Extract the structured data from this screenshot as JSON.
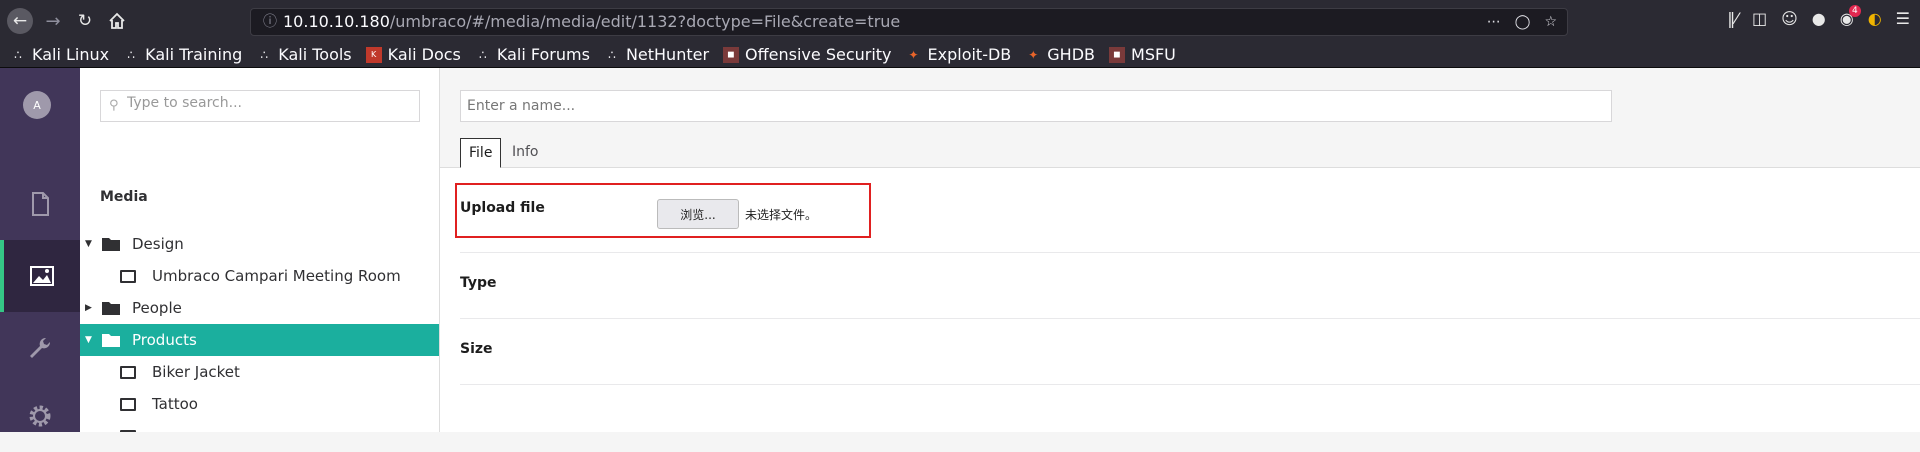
{
  "browser": {
    "url_host": "10.10.10.180",
    "url_path": "/umbraco/#/media/media/edit/1132?doctype=File&create=true",
    "notification_count": "4"
  },
  "bookmarks": [
    {
      "label": "Kali Linux",
      "icon": "kali-dragon-icon"
    },
    {
      "label": "Kali Training",
      "icon": "kali-dragon-icon"
    },
    {
      "label": "Kali Tools",
      "icon": "kali-dragon-icon"
    },
    {
      "label": "Kali Docs",
      "icon": "kali-docs-icon"
    },
    {
      "label": "Kali Forums",
      "icon": "kali-dragon-icon"
    },
    {
      "label": "NetHunter",
      "icon": "nethunter-icon"
    },
    {
      "label": "Offensive Security",
      "icon": "offsec-icon"
    },
    {
      "label": "Exploit-DB",
      "icon": "exploitdb-icon"
    },
    {
      "label": "GHDB",
      "icon": "ghdb-icon"
    },
    {
      "label": "MSFU",
      "icon": "msfu-icon"
    }
  ],
  "sidebar": {
    "avatar_initial": "A",
    "sections": [
      "content-icon",
      "media-icon",
      "settings-wrench-icon",
      "gear-icon"
    ],
    "active_section": "media-icon"
  },
  "tree": {
    "search_placeholder": "Type to search...",
    "title": "Media",
    "nodes": [
      {
        "label": "Design",
        "type": "folder",
        "expanded": true
      },
      {
        "label": "Umbraco Campari Meeting Room",
        "type": "image"
      },
      {
        "label": "People",
        "type": "folder",
        "expanded": false
      },
      {
        "label": "Products",
        "type": "folder",
        "expanded": true,
        "selected": true
      },
      {
        "label": "Biker Jacket",
        "type": "image"
      },
      {
        "label": "Tattoo",
        "type": "image"
      }
    ]
  },
  "editor": {
    "name_placeholder": "Enter a name...",
    "tabs": [
      "File",
      "Info"
    ],
    "active_tab": "File",
    "properties": {
      "upload_label": "Upload file",
      "browse_label": "浏览...",
      "no_file_label": "未选择文件。",
      "type_label": "Type",
      "size_label": "Size"
    }
  },
  "colors": {
    "sidebar_bg": "#413659",
    "selected_node": "#1baf9e",
    "highlight_border": "#e02020"
  }
}
